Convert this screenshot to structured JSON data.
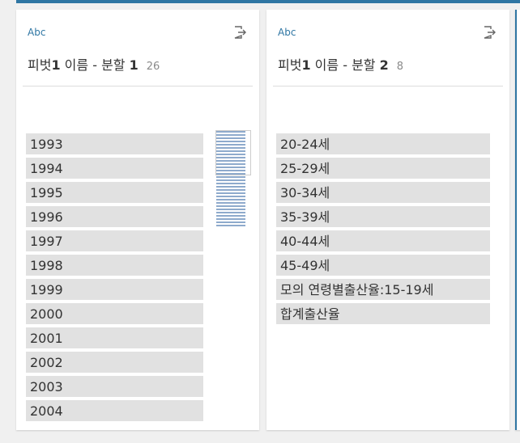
{
  "colors": {
    "accent": "#2f76a3",
    "value_bg": "#e1e1e1",
    "histogram_bar": "#8eaacc"
  },
  "fields": [
    {
      "type_label": "Abc",
      "name_prefix": "피벗",
      "name_num": "1",
      "name_mid": " 이름 - 분할 ",
      "name_suffix_num": "1",
      "count": "26",
      "export_icon": "export-icon",
      "values": [
        "1993",
        "1994",
        "1995",
        "1996",
        "1997",
        "1998",
        "1999",
        "2000",
        "2001",
        "2002",
        "2003",
        "2004"
      ]
    },
    {
      "type_label": "Abc",
      "name_prefix": "피벗",
      "name_num": "1",
      "name_mid": " 이름 - 분할 ",
      "name_suffix_num": "2",
      "count": "8",
      "export_icon": "export-icon",
      "values": [
        "20-24세",
        "25-29세",
        "30-34세",
        "35-39세",
        "40-44세",
        "45-49세",
        "모의 연령별출산율:15-19세",
        "합계출산율"
      ]
    }
  ]
}
